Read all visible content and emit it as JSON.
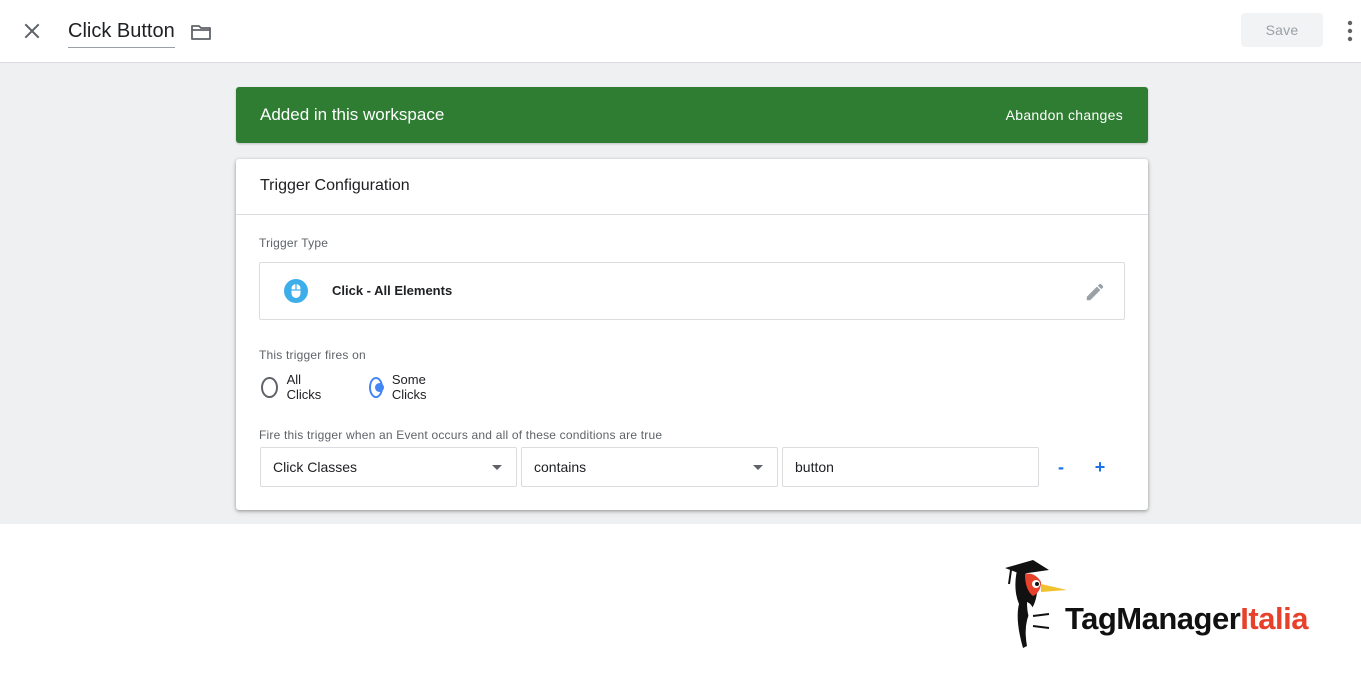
{
  "header": {
    "title": "Click Button",
    "save_label": "Save",
    "icons": {
      "close": "close-icon",
      "folder": "folder-icon",
      "more": "more-vert-icon"
    }
  },
  "banner": {
    "text": "Added in this workspace",
    "action_label": "Abandon changes",
    "color": "#2e7d32"
  },
  "card": {
    "title": "Trigger Configuration",
    "trigger_type_label": "Trigger Type",
    "trigger_type": {
      "name": "Click - All Elements",
      "icon": "mouse-icon",
      "icon_color": "#3daee9",
      "edit_icon": "pencil-icon"
    },
    "fires_on_label": "This trigger fires on",
    "fires_on_options": [
      {
        "label": "All Clicks",
        "checked": false
      },
      {
        "label": "Some Clicks",
        "checked": true
      }
    ],
    "conditions_label": "Fire this trigger when an Event occurs and all of these conditions are true",
    "condition": {
      "variable": "Click Classes",
      "operator": "contains",
      "value": "button",
      "remove_label": "-",
      "add_label": "+"
    }
  },
  "logo": {
    "text_dark": "TagManager",
    "text_red": "Italia"
  },
  "colors": {
    "accent_blue": "#4285f4",
    "link_blue": "#1a73e8",
    "logo_red": "#e8412b"
  }
}
